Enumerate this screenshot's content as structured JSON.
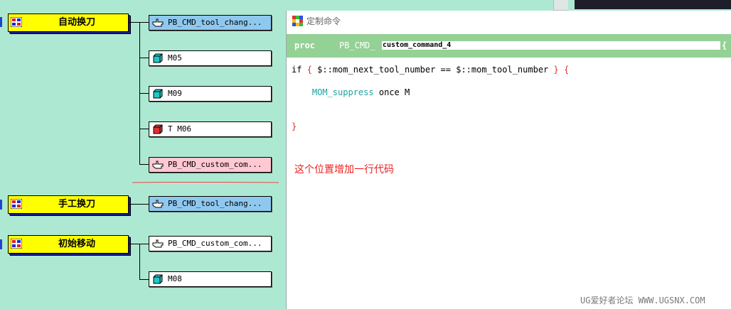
{
  "groups": [
    {
      "label": "自动换刀",
      "items": [
        {
          "label": "PB_CMD_tool_chang...",
          "type": "cmd",
          "style": "blue"
        },
        {
          "label": "M05",
          "type": "block",
          "style": "white"
        },
        {
          "label": "M09",
          "type": "block",
          "style": "white"
        },
        {
          "label": "T M06",
          "type": "block-red",
          "style": "white"
        },
        {
          "label": "PB_CMD_custom_com...",
          "type": "cmd",
          "style": "pink"
        }
      ]
    },
    {
      "label": "手工换刀",
      "items": [
        {
          "label": "PB_CMD_tool_chang...",
          "type": "cmd",
          "style": "blue"
        }
      ]
    },
    {
      "label": "初始移动",
      "items": [
        {
          "label": "PB_CMD_custom_com...",
          "type": "cmd",
          "style": "white"
        },
        {
          "label": "M08",
          "type": "block",
          "style": "white"
        }
      ]
    }
  ],
  "window": {
    "title": "定制命令",
    "proc_keyword": "proc",
    "proc_prefix": "PB_CMD_",
    "proc_name": "custom_command_4",
    "proc_brace": "{"
  },
  "code": {
    "line1": {
      "kw": "if",
      "ob": "{",
      "cond": "$::mom_next_tool_number == $::mom_tool_number",
      "cb": "}",
      "brace": "{"
    },
    "line2": {
      "cmd": "MOM_suppress",
      "rest": "once M"
    },
    "line3": {
      "brace": "}"
    }
  },
  "annotation": "这个位置增加一行代码",
  "watermark": "UG爱好者论坛 WWW.UGSNX.COM",
  "colors": {
    "background": "#ade9d2",
    "group_fill": "#ffff00",
    "proc_bar": "#94d194",
    "annotation": "#ee2020",
    "cmd_blue": "#8fc8ee",
    "cmd_pink": "#ffc8d2"
  }
}
